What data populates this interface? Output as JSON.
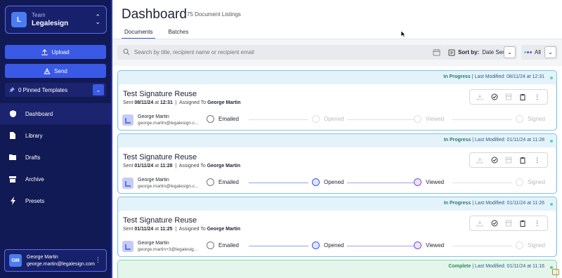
{
  "sidebar": {
    "team_label": "Team",
    "team_name": "Legalesign",
    "team_initial": "L",
    "upload_label": "Upload",
    "send_label": "Send",
    "pinned_label": "0 Pinned Templates",
    "nav": [
      {
        "label": "Dashboard",
        "icon": "shield-icon",
        "active": true
      },
      {
        "label": "Library",
        "icon": "document-icon",
        "active": false
      },
      {
        "label": "Drafts",
        "icon": "folder-icon",
        "active": false
      },
      {
        "label": "Archive",
        "icon": "archive-icon",
        "active": false
      },
      {
        "label": "Presets",
        "icon": "lightning-icon",
        "active": false
      }
    ],
    "user": {
      "initials": "GM",
      "name": "George Martin",
      "email": "george.martin@legalesign.com"
    }
  },
  "header": {
    "title": "Dashboard",
    "subtitle": "75 Document Listings",
    "tabs": [
      "Documents",
      "Batches"
    ]
  },
  "toolbar": {
    "search_placeholder": "Search by title, recipient name or recipient email",
    "sort_label": "Sort by:",
    "sort_value": "Date Sent",
    "filter_value": "All"
  },
  "cards": [
    {
      "status": "In Progress",
      "modified": "Last Modified: 08/11/24 at 12:31",
      "title": "Test Signature Reuse",
      "sent_prefix": "Sent",
      "sent_date": "08/11/24",
      "sent_at": "at",
      "sent_time": "12:31",
      "assigned_prefix": "Assigned To",
      "assigned_to": "George Martin",
      "recipient_name": "George Martin",
      "recipient_email": "george.martin@legalesign.c...",
      "steps": [
        "Emailed",
        "Opened",
        "Viewed",
        "Signed"
      ],
      "progress": 1
    },
    {
      "status": "In Progress",
      "modified": "Last Modified: 01/11/24 at 11:28",
      "title": "Test Signature Reuse",
      "sent_prefix": "Sent",
      "sent_date": "01/11/24",
      "sent_at": "at",
      "sent_time": "11:28",
      "assigned_prefix": "Assigned To",
      "assigned_to": "George Martin",
      "recipient_name": "George Martin",
      "recipient_email": "george.martin@legalesign.c...",
      "steps": [
        "Emailed",
        "Opened",
        "Viewed",
        "Signed"
      ],
      "progress": 3
    },
    {
      "status": "In Progress",
      "modified": "Last Modified: 01/11/24 at 11:26",
      "title": "Test Signature Reuse",
      "sent_prefix": "Sent",
      "sent_date": "01/11/24",
      "sent_at": "at",
      "sent_time": "11:25",
      "assigned_prefix": "Assigned To",
      "assigned_to": "George Martin",
      "recipient_name": "George Martin",
      "recipient_email": "george.martin+3@legalesig...",
      "steps": [
        "Emailed",
        "Opened",
        "Viewed",
        "Signed"
      ],
      "progress": 3
    },
    {
      "status": "Complete",
      "modified": "Last Modified: 01/11/24 at 11:16"
    }
  ],
  "colors": {
    "sidebar_bg": "#121a55",
    "accent": "#3a59e4",
    "in_progress_border": "#7fc3e8",
    "complete_border": "#7fd8a8",
    "opened": "#3a59e4",
    "viewed": "#7c4dd4"
  }
}
